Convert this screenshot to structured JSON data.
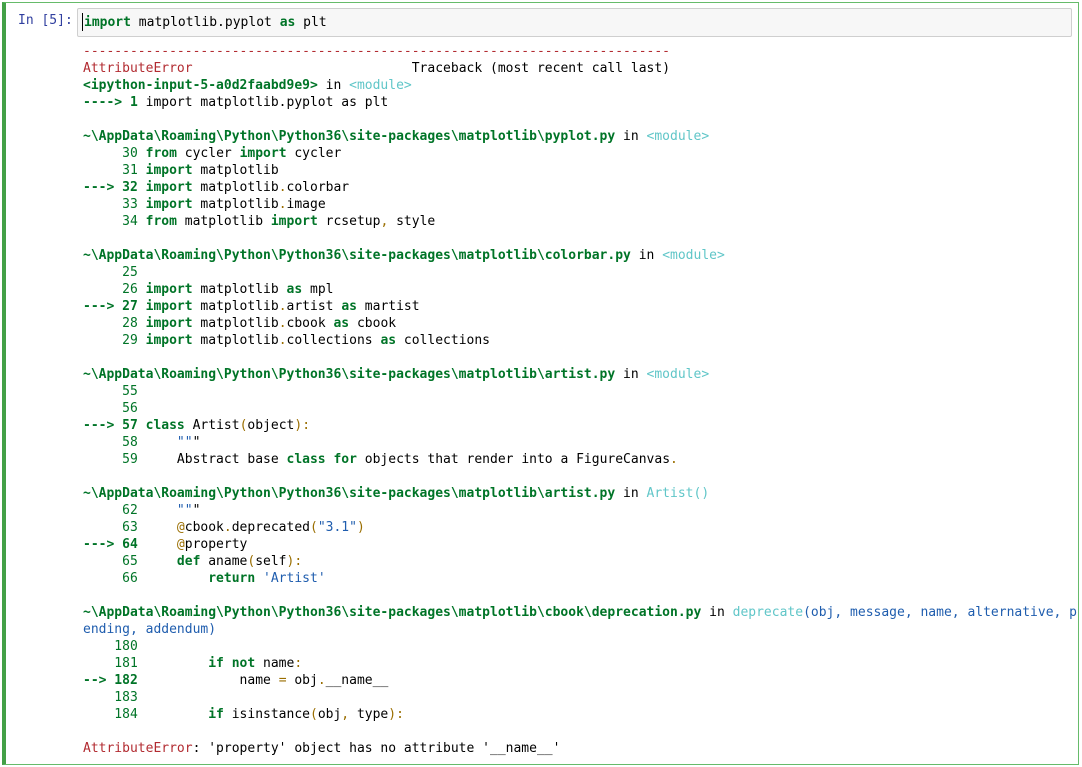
{
  "prompt": "In [5]:",
  "input_code": "import matplotlib.pyplot as plt",
  "traceback": {
    "separator": "---------------------------------------------------------------------------",
    "error_name": "AttributeError",
    "header_right": "Traceback (most recent call last)",
    "frame0_file": "<ipython-input-5-a0d2faabd9e9>",
    "frame0_in": " in ",
    "frame0_func": "<module>",
    "frame0_arrow": "----> 1 ",
    "frame0_code": "import matplotlib.pyplot as plt",
    "frame1_file": "~\\AppData\\Roaming\\Python\\Python36\\site-packages\\matplotlib\\pyplot.py",
    "frame1_func": "<module>",
    "frame1_lines": [
      {
        "prefix": "     30 ",
        "code": "from cycler import cycler"
      },
      {
        "prefix": "     31 ",
        "code": "import matplotlib"
      },
      {
        "prefix": "---> 32 ",
        "code": "import matplotlib.colorbar"
      },
      {
        "prefix": "     33 ",
        "code": "import matplotlib.image"
      },
      {
        "prefix": "     34 ",
        "code": "from matplotlib import rcsetup, style"
      }
    ],
    "frame2_file": "~\\AppData\\Roaming\\Python\\Python36\\site-packages\\matplotlib\\colorbar.py",
    "frame2_func": "<module>",
    "frame2_lines": [
      {
        "prefix": "     25",
        "code": ""
      },
      {
        "prefix": "     26 ",
        "code": "import matplotlib as mpl"
      },
      {
        "prefix": "---> 27 ",
        "code": "import matplotlib.artist as martist"
      },
      {
        "prefix": "     28 ",
        "code": "import matplotlib.cbook as cbook"
      },
      {
        "prefix": "     29 ",
        "code": "import matplotlib.collections as collections"
      }
    ],
    "frame3_file": "~\\AppData\\Roaming\\Python\\Python36\\site-packages\\matplotlib\\artist.py",
    "frame3_func": "<module>",
    "frame3_lines": [
      {
        "prefix": "     55",
        "code": ""
      },
      {
        "prefix": "     56",
        "code": ""
      },
      {
        "prefix": "---> 57 ",
        "code": "class Artist(object):"
      },
      {
        "prefix": "     58     ",
        "code": "\"\"\""
      },
      {
        "prefix": "     59     ",
        "code": "Abstract base class for objects that render into a FigureCanvas."
      }
    ],
    "frame4_file": "~\\AppData\\Roaming\\Python\\Python36\\site-packages\\matplotlib\\artist.py",
    "frame4_func": "Artist()",
    "frame4_lines": [
      {
        "prefix": "     62     ",
        "code": "\"\"\""
      },
      {
        "prefix": "     63     ",
        "code": "@cbook.deprecated(\"3.1\")"
      },
      {
        "prefix": "---> 64     ",
        "code": "@property"
      },
      {
        "prefix": "     65     ",
        "code": "def aname(self):"
      },
      {
        "prefix": "     66         ",
        "code": "return 'Artist'"
      }
    ],
    "frame5_file": "~\\AppData\\Roaming\\Python\\Python36\\site-packages\\matplotlib\\cbook\\deprecation.py",
    "frame5_func": "deprecate",
    "frame5_args_line1": "(obj, message, name, alternative, p",
    "frame5_args_line2": "ending, addendum)",
    "frame5_lines": [
      {
        "prefix": "    180",
        "code": ""
      },
      {
        "prefix": "    181         ",
        "code": "if not name:"
      },
      {
        "prefix": "--> 182             ",
        "code": "name = obj.__name__"
      },
      {
        "prefix": "    183",
        "code": ""
      },
      {
        "prefix": "    184         ",
        "code": "if isinstance(obj, type):"
      }
    ],
    "final_error_name": "AttributeError",
    "final_message": ": 'property' object has no attribute '__name__'"
  }
}
